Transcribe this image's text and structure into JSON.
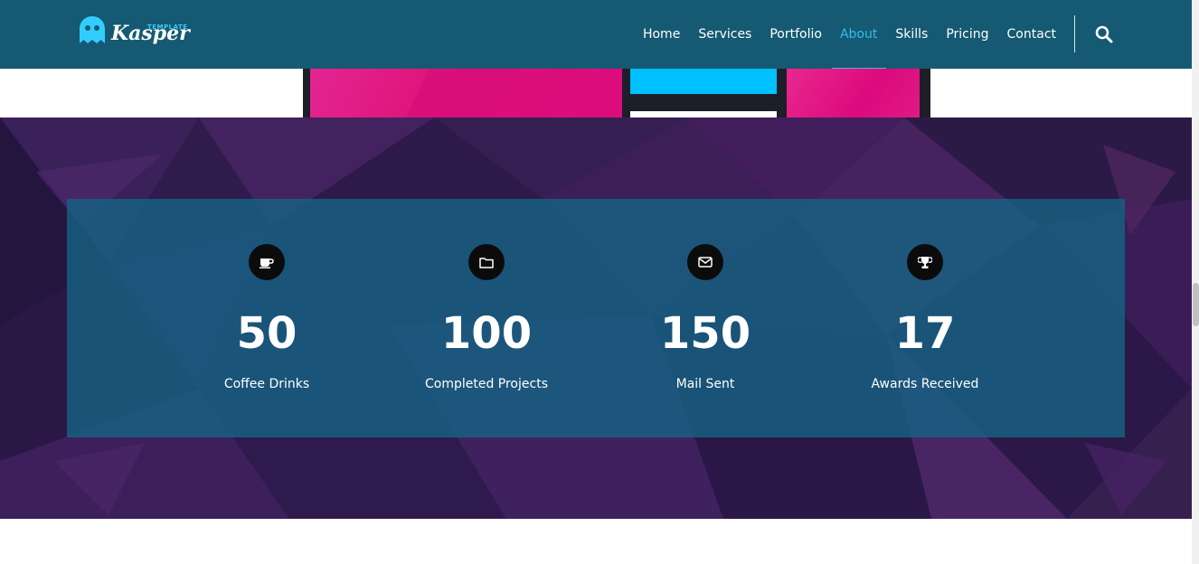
{
  "header": {
    "logo": {
      "name": "Kasper",
      "tag": "TEMPLATE"
    },
    "nav": [
      {
        "label": "Home",
        "active": false
      },
      {
        "label": "Services",
        "active": false
      },
      {
        "label": "Portfolio",
        "active": false
      },
      {
        "label": "About",
        "active": true
      },
      {
        "label": "Skills",
        "active": false
      },
      {
        "label": "Pricing",
        "active": false
      },
      {
        "label": "Contact",
        "active": false
      }
    ],
    "search_icon": "search-icon"
  },
  "counters": [
    {
      "icon": "coffee-icon",
      "value": "50",
      "label": "Coffee Drinks"
    },
    {
      "icon": "folder-icon",
      "value": "100",
      "label": "Completed Projects"
    },
    {
      "icon": "mail-icon",
      "value": "150",
      "label": "Mail Sent"
    },
    {
      "icon": "trophy-icon",
      "value": "17",
      "label": "Awards Received"
    }
  ],
  "colors": {
    "header_bg": "#155a72",
    "accent": "#33bbee",
    "counter_box": "#166282",
    "logo_blue": "#33ccff"
  }
}
